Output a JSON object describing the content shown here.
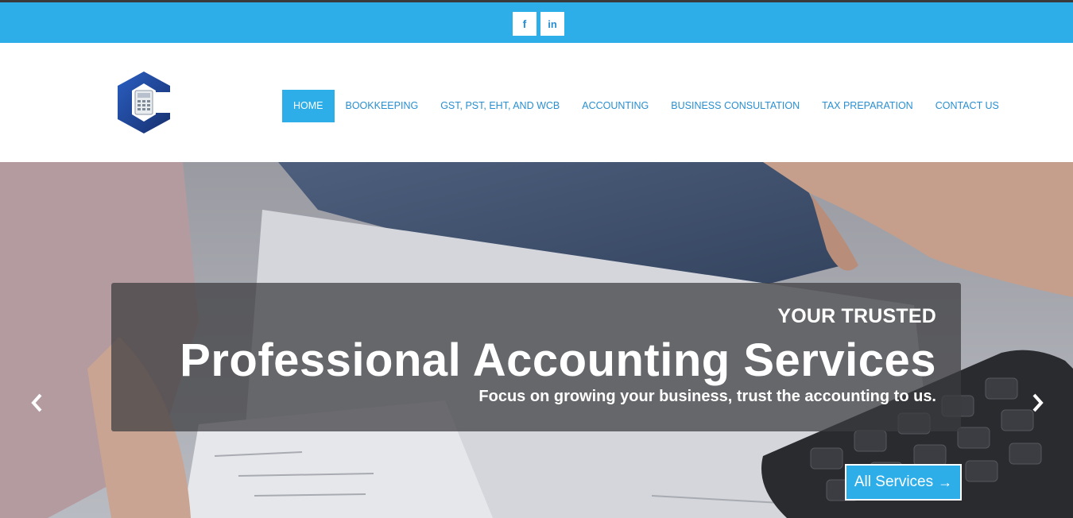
{
  "social": {
    "facebook_glyph": "f",
    "linkedin_glyph": "in"
  },
  "nav": {
    "items": [
      {
        "label": "HOME",
        "active": true
      },
      {
        "label": "BOOKKEEPING"
      },
      {
        "label": "GST, PST, EHT, AND WCB"
      },
      {
        "label": "ACCOUNTING"
      },
      {
        "label": "BUSINESS CONSULTATION"
      },
      {
        "label": "TAX PREPARATION"
      },
      {
        "label": "CONTACT US"
      }
    ]
  },
  "hero": {
    "kicker": "YOUR TRUSTED",
    "title": "Professional Accounting Services",
    "subtitle": "Focus on growing your business, trust the accounting to us.",
    "cta_label": "All Services",
    "cta_arrow": "→"
  },
  "colors": {
    "accent": "#2daee9",
    "nav_text": "#2a8fd0",
    "logo_blue": "#1c3f8a"
  }
}
